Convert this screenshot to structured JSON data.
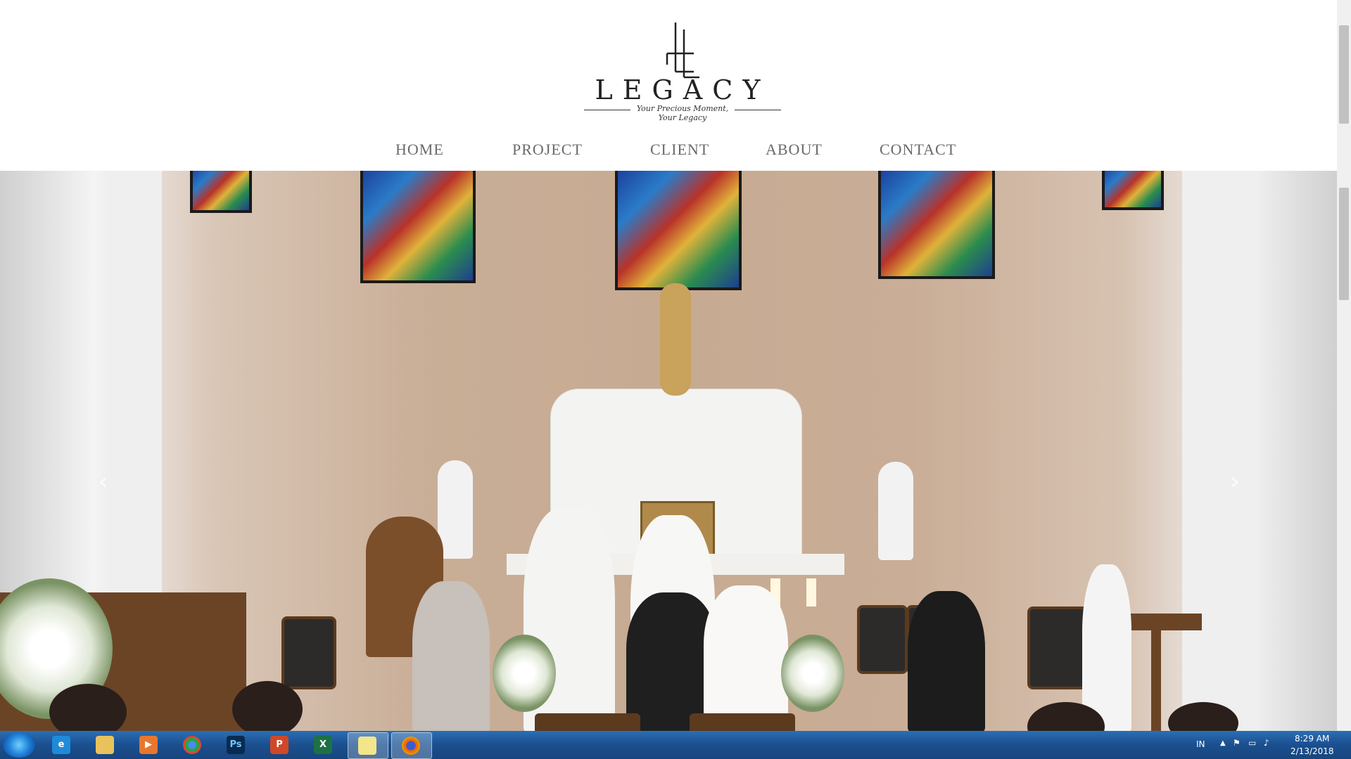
{
  "logo": {
    "word": "LEGACY",
    "tagline": "Your Precious Moment, Your Legacy"
  },
  "nav": {
    "items": [
      {
        "label": "HOME"
      },
      {
        "label": "PROJECT"
      },
      {
        "label": "CLIENT"
      },
      {
        "label": "ABOUT"
      },
      {
        "label": "CONTACT"
      }
    ]
  },
  "slider": {
    "prev_icon": "chevron-left-icon",
    "next_icon": "chevron-right-icon",
    "prev_glyph": "‹",
    "next_glyph": "›"
  },
  "taskbar": {
    "apps": [
      {
        "name": "internet-explorer",
        "glyph": "e",
        "color": "#1f8bd8"
      },
      {
        "name": "file-explorer",
        "glyph": "",
        "color": "#e9c25c"
      },
      {
        "name": "media-player",
        "glyph": "▶",
        "color": "#e8772e"
      },
      {
        "name": "chrome",
        "glyph": "",
        "color": "#2aa34a"
      },
      {
        "name": "photoshop",
        "glyph": "Ps",
        "color": "#0b2a4f"
      },
      {
        "name": "powerpoint",
        "glyph": "P",
        "color": "#d24726"
      },
      {
        "name": "excel",
        "glyph": "X",
        "color": "#1e7145"
      },
      {
        "name": "sticky-notes",
        "glyph": "",
        "color": "#f3e58a"
      },
      {
        "name": "firefox",
        "glyph": "",
        "color": "#e66000"
      }
    ],
    "tray": {
      "language": "IN",
      "time": "8:29 AM",
      "date": "2/13/2018"
    }
  }
}
